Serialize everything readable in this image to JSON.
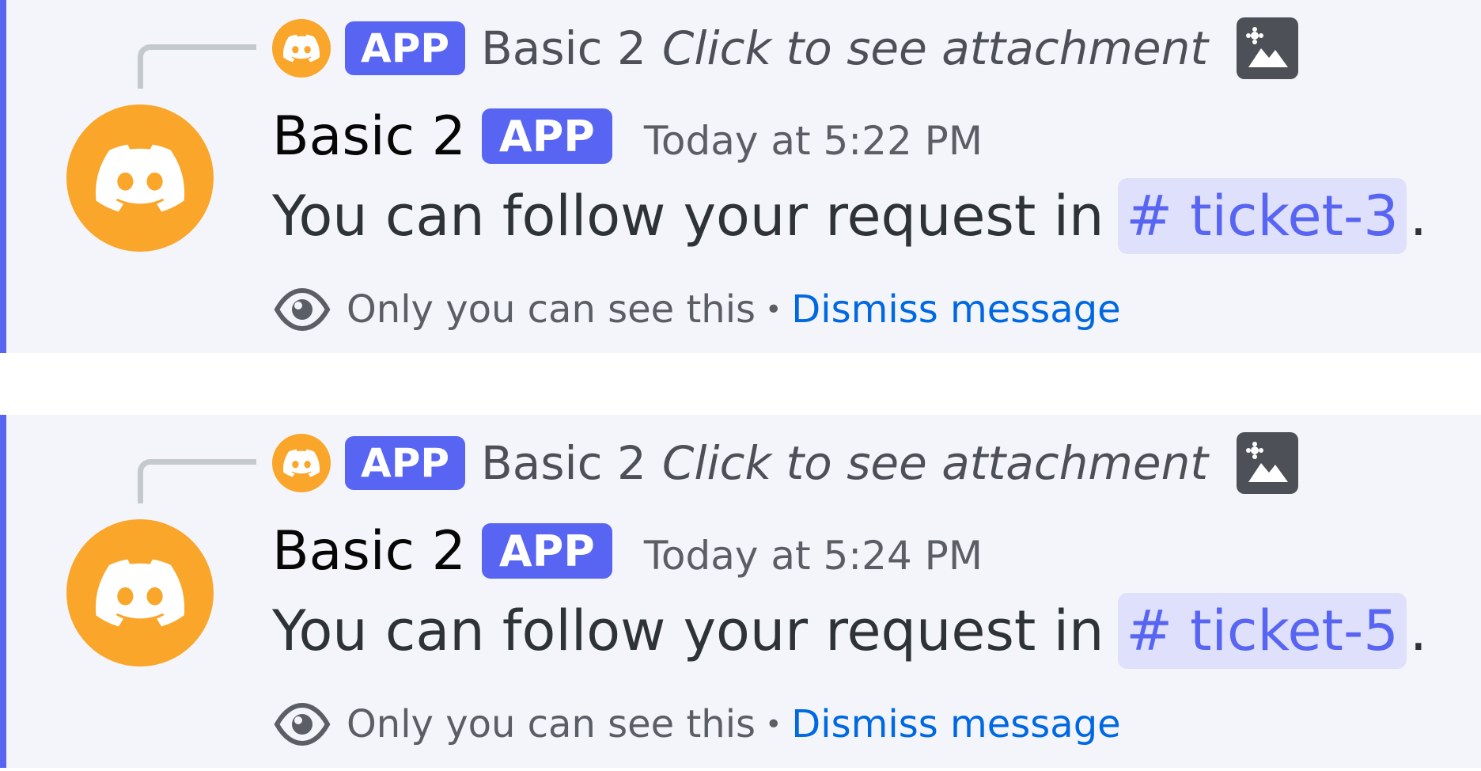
{
  "messages": [
    {
      "reply": {
        "badge": "APP",
        "author": "Basic 2",
        "attachment_text": "Click to see attachment",
        "avatar_icon": "discord-logo-icon",
        "attachment_icon": "image-icon"
      },
      "author": "Basic 2",
      "badge": "APP",
      "timestamp": "Today at 5:22 PM",
      "text": "You can follow your request in",
      "channel_hash": "#",
      "channel": "ticket-3",
      "period": ".",
      "ephemeral_notice": "Only you can see this",
      "separator": "•",
      "dismiss_label": "Dismiss message"
    },
    {
      "reply": {
        "badge": "APP",
        "author": "Basic 2",
        "attachment_text": "Click to see attachment",
        "avatar_icon": "discord-logo-icon",
        "attachment_icon": "image-icon"
      },
      "author": "Basic 2",
      "badge": "APP",
      "timestamp": "Today at 5:24 PM",
      "text": "You can follow your request in",
      "channel_hash": "#",
      "channel": "ticket-5",
      "period": ".",
      "ephemeral_notice": "Only you can see this",
      "separator": "•",
      "dismiss_label": "Dismiss message"
    }
  ],
  "colors": {
    "accent": "#5865f2",
    "avatar": "#f9a62b",
    "link": "#0068e0",
    "mention_bg": "#dee0fc",
    "message_bg": "#f4f5fb"
  }
}
